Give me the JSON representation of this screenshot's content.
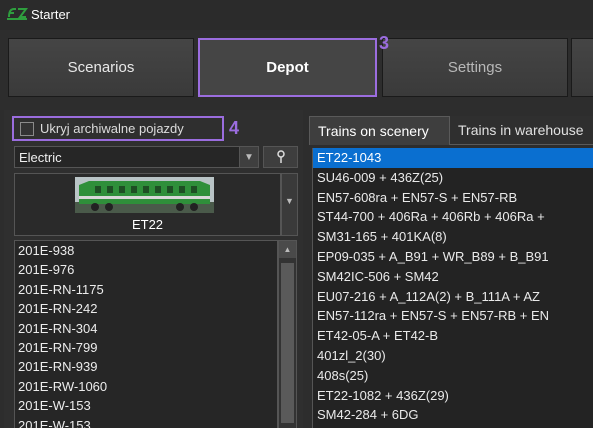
{
  "window": {
    "title": "Starter"
  },
  "main_tabs": [
    {
      "label": "Scenarios"
    },
    {
      "label": "Depot"
    },
    {
      "label": "Settings"
    }
  ],
  "callouts": {
    "depot": "3",
    "hide_archival": "4"
  },
  "left": {
    "hide_archival_label": "Ukryj archiwalne pojazdy",
    "type_filter": "Electric",
    "preview_name": "ET22",
    "vehicles": [
      "201E-938",
      "201E-976",
      "201E-RN-1175",
      "201E-RN-242",
      "201E-RN-304",
      "201E-RN-799",
      "201E-RN-939",
      "201E-RW-1060",
      "201E-W-153",
      "201E-W-153"
    ]
  },
  "right": {
    "tabs": [
      "Trains on scenery",
      "Trains in warehouse"
    ],
    "trains": [
      "ET22-1043",
      "SU46-009 + 436Z(25)",
      "EN57-608ra + EN57-S + EN57-RB",
      "ST44-700 + 406Ra + 406Rb + 406Ra +",
      "SM31-165 + 401KA(8)",
      "EP09-035 + A_B91 + WR_B89 + B_B91",
      "SM42IC-506 + SM42",
      "EU07-216 + A_112A(2) + B_111A + AZ",
      "EN57-112ra + EN57-S + EN57-RB + EN",
      "ET42-05-A + ET42-B",
      "401zl_2(30)",
      "408s(25)",
      "ET22-1082 + 436Z(29)",
      "SM42-284 + 6DG"
    ]
  },
  "colors": {
    "accent": "#9b6ddf",
    "selection": "#0a6fd0",
    "logo": "#2e9e3e"
  }
}
